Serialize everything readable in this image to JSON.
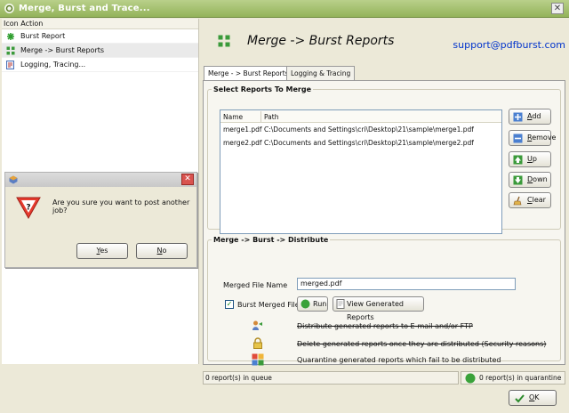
{
  "window": {
    "title": "Merge, Burst and Trace...",
    "close_glyph": "✕"
  },
  "left_panel": {
    "header": "Icon Action",
    "items": [
      {
        "label": "Burst Report",
        "icon": "burst-report-icon"
      },
      {
        "label": "Merge -> Burst Reports",
        "icon": "merge-burst-icon"
      },
      {
        "label": "Logging, Tracing...",
        "icon": "logging-icon"
      }
    ]
  },
  "header": {
    "title": "Merge -> Burst Reports",
    "support_email": "support@pdfburst.com"
  },
  "tabs": [
    {
      "label": "Merge - > Burst Reports",
      "active": true
    },
    {
      "label": "Logging & Tracing",
      "active": false
    }
  ],
  "select_reports": {
    "legend": "Select Reports To Merge",
    "columns": [
      "Name",
      "Path"
    ],
    "rows": [
      {
        "name": "merge1.pdf",
        "path": "C:\\Documents and Settings\\cri\\Desktop\\21\\sample\\merge1.pdf"
      },
      {
        "name": "merge2.pdf",
        "path": "C:\\Documents and Settings\\cri\\Desktop\\21\\sample\\merge2.pdf"
      }
    ],
    "buttons": {
      "add": {
        "hotkey": "A",
        "rest": "dd"
      },
      "remove": {
        "hotkey": "R",
        "rest": "emove"
      },
      "up": {
        "hotkey": "U",
        "rest": "p"
      },
      "down": {
        "hotkey": "D",
        "rest": "own"
      },
      "clear": {
        "hotkey": "C",
        "rest": "lear"
      }
    }
  },
  "distribute": {
    "legend": "Merge -> Burst -> Distribute",
    "merged_file_label": "Merged File Name",
    "merged_file_value": "merged.pdf",
    "burst_checkbox_label": "Burst Merged File",
    "burst_checked": true,
    "run_label": "Run",
    "view_reports_label": "View Generated Reports",
    "options": [
      {
        "text": "Distribute generated reports to E-mail and/or FTP",
        "disabled": true,
        "icon": "distribute-icon"
      },
      {
        "text": "Delete generated reports once they are distributed (Security reasons)",
        "disabled": true,
        "icon": "lock-icon"
      },
      {
        "text": "Quarantine generated reports which fail to be distributed",
        "disabled": false,
        "icon": "quarantine-icon"
      }
    ]
  },
  "status": {
    "queue": "0 report(s) in queue",
    "quarantine": "0 report(s) in quarantine"
  },
  "ok_button": {
    "hotkey": "O",
    "rest": "K"
  },
  "dialog": {
    "message": "Are you sure you want to post another job?",
    "yes": {
      "hotkey": "Y",
      "rest": "es"
    },
    "no": {
      "hotkey": "N",
      "rest": "o"
    },
    "close_glyph": "✕"
  },
  "colors": {
    "title_bar": "#9dbb62",
    "support_link": "#0033cc",
    "list_border": "#7f9db9"
  }
}
